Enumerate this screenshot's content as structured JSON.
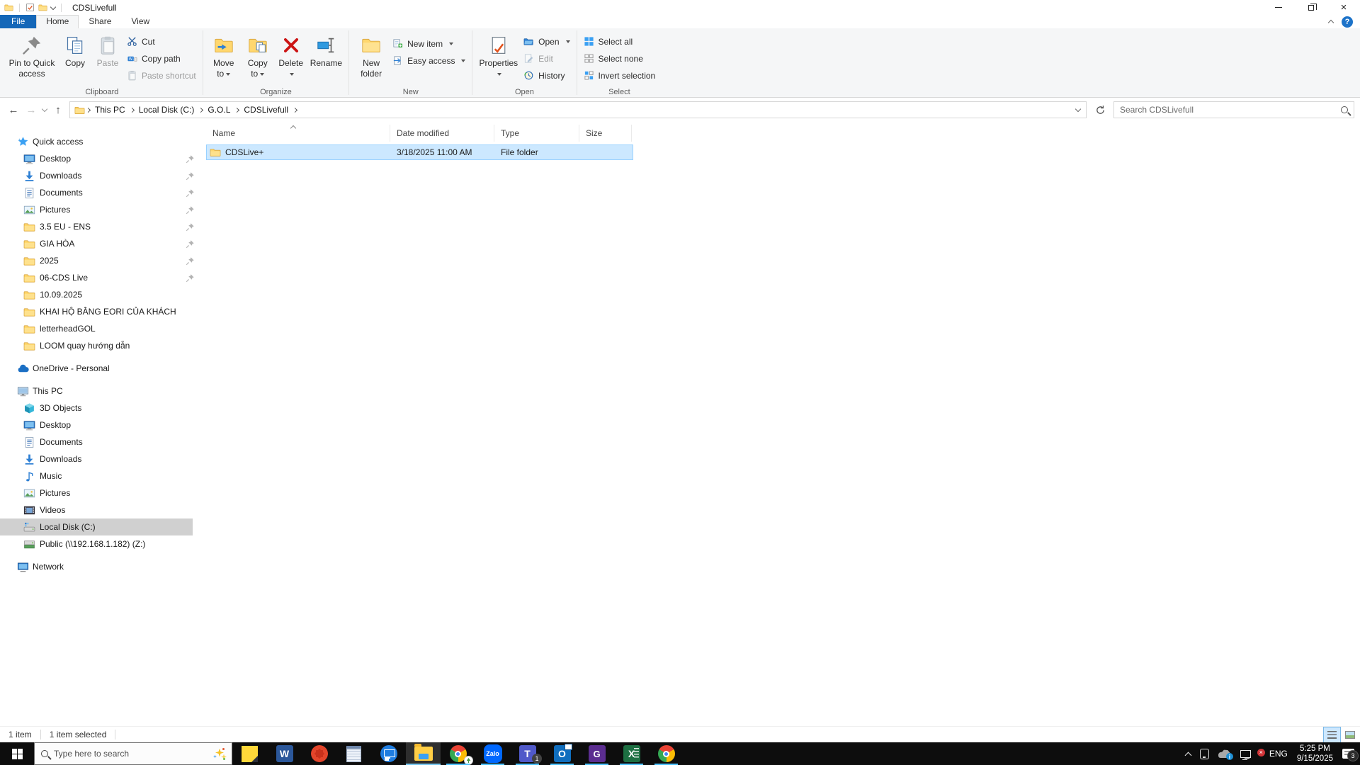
{
  "colors": {
    "accent": "#1467b8",
    "selection_fill": "#cce8ff",
    "selection_border": "#99d1ff",
    "sidebar_selected": "#d0d0d0",
    "taskbar_bg": "#0d0d0d",
    "folder_yellow": "#ffd76e"
  },
  "titlebar": {
    "title": "CDSLivefull"
  },
  "menu": {
    "file_label": "File",
    "tabs": [
      {
        "label": "Home"
      },
      {
        "label": "Share"
      },
      {
        "label": "View"
      }
    ],
    "active_tab": "Home",
    "help_label": "?"
  },
  "ribbon": {
    "clipboard": {
      "label": "Clipboard",
      "pin": "Pin to Quick access",
      "copy": "Copy",
      "paste": "Paste",
      "cut": "Cut",
      "copy_path": "Copy path",
      "paste_shortcut": "Paste shortcut"
    },
    "organize": {
      "label": "Organize",
      "move_to": "Move to",
      "copy_to": "Copy to",
      "delete": "Delete",
      "rename": "Rename"
    },
    "new": {
      "label": "New",
      "new_folder": "New folder",
      "new_item": "New item",
      "easy_access": "Easy access"
    },
    "open": {
      "label": "Open",
      "properties": "Properties",
      "open": "Open",
      "edit": "Edit",
      "history": "History"
    },
    "select": {
      "label": "Select",
      "select_all": "Select all",
      "select_none": "Select none",
      "invert": "Invert selection"
    }
  },
  "addressbar": {
    "breadcrumb": [
      {
        "label": "This PC"
      },
      {
        "label": "Local Disk (C:)"
      },
      {
        "label": "G.O.L"
      },
      {
        "label": "CDSLivefull"
      }
    ],
    "search_placeholder": "Search CDSLivefull"
  },
  "sidebar": {
    "quick_access": {
      "label": "Quick access",
      "items": [
        {
          "label": "Desktop",
          "icon": "desktop",
          "pinned": true
        },
        {
          "label": "Downloads",
          "icon": "downloads",
          "pinned": true
        },
        {
          "label": "Documents",
          "icon": "documents",
          "pinned": true
        },
        {
          "label": "Pictures",
          "icon": "pictures",
          "pinned": true
        },
        {
          "label": "3.5 EU - ENS",
          "icon": "folder",
          "pinned": true
        },
        {
          "label": "GIA HÒA",
          "icon": "folder",
          "pinned": true
        },
        {
          "label": "2025",
          "icon": "folder",
          "pinned": true
        },
        {
          "label": "06-CDS Live",
          "icon": "folder",
          "pinned": true
        },
        {
          "label": "10.09.2025",
          "icon": "folder",
          "pinned": false
        },
        {
          "label": "KHAI HỘ BẰNG EORI CỦA KHÁCH",
          "icon": "folder",
          "pinned": false
        },
        {
          "label": "letterheadGOL",
          "icon": "folder",
          "pinned": false
        },
        {
          "label": "LOOM quay hướng dẫn",
          "icon": "folder",
          "pinned": false
        }
      ]
    },
    "onedrive": {
      "label": "OneDrive - Personal"
    },
    "this_pc": {
      "label": "This PC",
      "items": [
        {
          "label": "3D Objects",
          "icon": "3d-objects",
          "selected": false
        },
        {
          "label": "Desktop",
          "icon": "desktop",
          "selected": false
        },
        {
          "label": "Documents",
          "icon": "documents",
          "selected": false
        },
        {
          "label": "Downloads",
          "icon": "downloads",
          "selected": false
        },
        {
          "label": "Music",
          "icon": "music",
          "selected": false
        },
        {
          "label": "Pictures",
          "icon": "pictures",
          "selected": false
        },
        {
          "label": "Videos",
          "icon": "videos",
          "selected": false
        },
        {
          "label": "Local Disk (C:)",
          "icon": "local-disk",
          "selected": true
        },
        {
          "label": "Public (\\\\192.168.1.182) (Z:)",
          "icon": "network-drive",
          "selected": false
        }
      ]
    },
    "network": {
      "label": "Network"
    }
  },
  "files": {
    "columns": [
      {
        "label": "Name",
        "sorted": "asc"
      },
      {
        "label": "Date modified"
      },
      {
        "label": "Type"
      },
      {
        "label": "Size"
      }
    ],
    "rows": [
      {
        "name": "CDSLive+",
        "date_modified": "3/18/2025 11:00 AM",
        "type": "File folder",
        "size": "",
        "selected": true
      }
    ]
  },
  "statusbar": {
    "count": "1 item",
    "selected": "1 item selected"
  },
  "taskbar": {
    "search_placeholder": "Type here to search",
    "letters": {
      "word": "W",
      "zalo": "Zalo",
      "teams": "T",
      "outlook": "O",
      "gapp": "G",
      "excel": "X"
    },
    "teams_badge": "1",
    "apps": [
      "sticky-notes",
      "word",
      "ecus",
      "notepad",
      "ultraviewer",
      "file-explorer",
      "chrome-profile",
      "zalo",
      "teams",
      "outlook",
      "g-app",
      "excel",
      "chrome"
    ],
    "active_app": "file-explorer",
    "tray": {
      "language": "ENG",
      "time": "5:25 PM",
      "date": "9/15/2025",
      "notifications": "3"
    }
  }
}
